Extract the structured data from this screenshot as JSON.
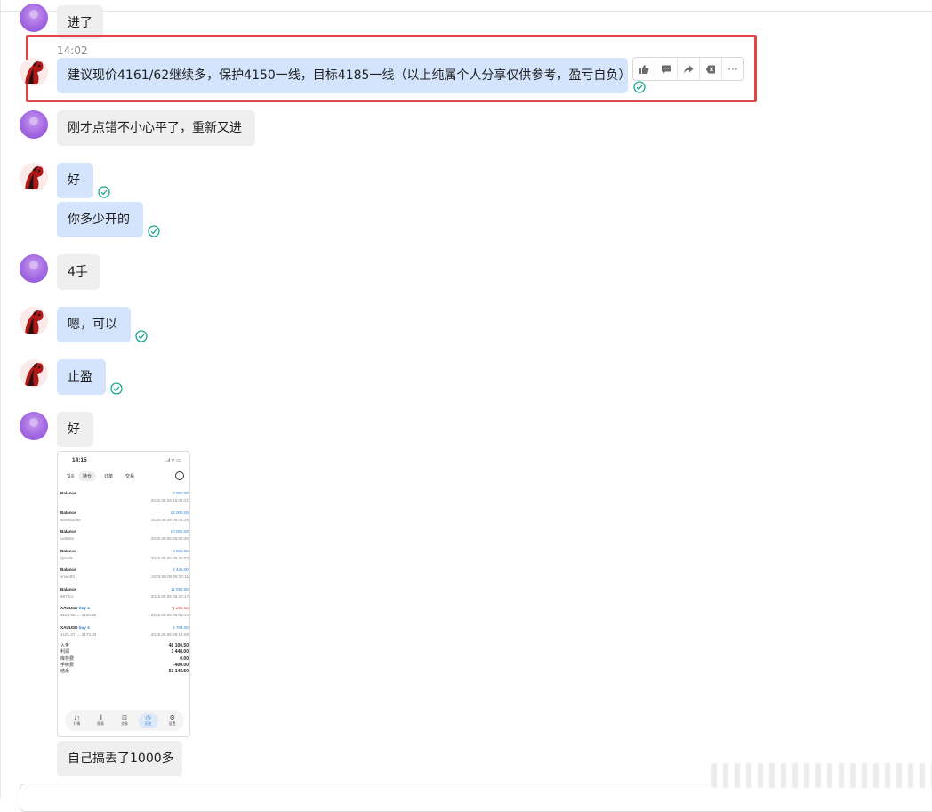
{
  "messages": [
    {
      "id": "m0",
      "sender": "other",
      "text": "进了"
    },
    {
      "id": "m1",
      "sender": "me",
      "time": "14:02",
      "text": "建议现价4161/62继续多，保护4150一线，目标4185一线（以上纯属个人分享仅供参考，盈亏自负）",
      "status": "read"
    },
    {
      "id": "m2",
      "sender": "other",
      "text": "刚才点错不小心平了，重新又进"
    },
    {
      "id": "m3",
      "sender": "me",
      "text": "好",
      "status": "read"
    },
    {
      "id": "m4",
      "sender": "me",
      "text": "你多少开的",
      "status": "read"
    },
    {
      "id": "m5",
      "sender": "other",
      "text": "4手"
    },
    {
      "id": "m6",
      "sender": "me",
      "text": "嗯，可以",
      "status": "read"
    },
    {
      "id": "m7",
      "sender": "me",
      "text": "止盈",
      "status": "read"
    },
    {
      "id": "m8",
      "sender": "other",
      "text": "好"
    },
    {
      "id": "m10",
      "sender": "other",
      "text": "自己搞丢了1000多"
    }
  ],
  "message_toolbar": {
    "actions": [
      "like-icon",
      "comment-icon",
      "forward-icon",
      "recall-icon",
      "more-icon"
    ],
    "more_label": "···"
  },
  "screenshot": {
    "time": "14:15",
    "status_icons": "..ıl ᯤ ▭",
    "menu_icon": "⇅≡",
    "tabs": [
      "持仓",
      "订单",
      "交易"
    ],
    "active_tab": 0,
    "rows": [
      {
        "title": "Balance",
        "sub": "",
        "value": "3 000.00",
        "date": "2025.08.04 16:01:21",
        "negative": false
      },
      {
        "title": "Balance",
        "sub": "a08dsuu98",
        "value": "12 000.00",
        "date": "2025.08.05 06:08:26",
        "negative": false
      },
      {
        "title": "Balance",
        "sub": "ux68ee",
        "value": "10 000.00",
        "date": "2025.08.05 06:08:30",
        "negative": false
      },
      {
        "title": "Balance",
        "sub": "dpw28",
        "value": "8 605.50",
        "date": "2025.08.06 06:20:03",
        "negative": false
      },
      {
        "title": "Balance",
        "sub": "vnwu93",
        "value": "3 445.00",
        "date": "2025.08.05 06:20:11",
        "negative": false
      },
      {
        "title": "Balance",
        "sub": "987dcc",
        "value": "11 050.00",
        "date": "2025.08.05 06:20:17",
        "negative": false
      },
      {
        "title": "XAUUSD",
        "buy": "buy 4",
        "sub": "4163.98 → 4160.42",
        "value": "-1 256.00",
        "date": "2025.08.05 09:03:14",
        "negative": true
      },
      {
        "title": "XAUUSD",
        "buy": "buy 4",
        "sub": "4161.07 → 4173.03",
        "value": "4 704.00",
        "date": "2025.08.05 09:14:05",
        "negative": false
      }
    ],
    "summary": [
      {
        "label": "入金",
        "value": "48 100.50"
      },
      {
        "label": "利润",
        "value": "3 448.00"
      },
      {
        "label": "库存费",
        "value": "0.00"
      },
      {
        "label": "手续费",
        "value": "-400.00"
      },
      {
        "label": "结余",
        "value": "51 148.50"
      }
    ],
    "nav": [
      {
        "label": "行情",
        "glyph": "↓↑"
      },
      {
        "label": "图表",
        "glyph": "⫴"
      },
      {
        "label": "交易",
        "glyph": "⊡"
      },
      {
        "label": "历史",
        "glyph": "◷"
      },
      {
        "label": "设置",
        "glyph": "⚙"
      }
    ],
    "active_nav": 3
  },
  "colors": {
    "bubble_other": "#efefef",
    "bubble_me": "#d3e4fc",
    "read_check": "#1aa68e",
    "highlight_border": "#e04848",
    "avatar_other": "#a368e2"
  }
}
